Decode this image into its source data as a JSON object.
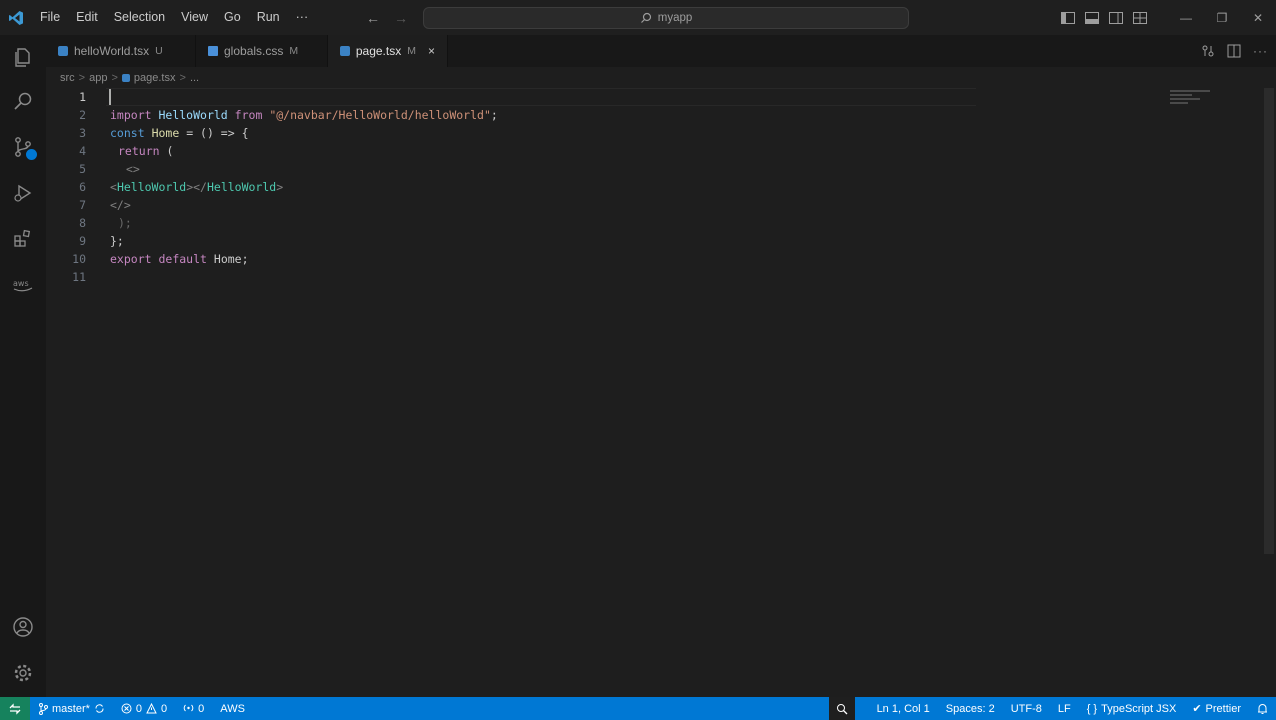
{
  "colors": {
    "accent": "#0078d4",
    "remote": "#16825d",
    "editor_bg": "#1e1e1e"
  },
  "menu": [
    "File",
    "Edit",
    "Selection",
    "View",
    "Go",
    "Run",
    "···"
  ],
  "search": {
    "text": "myapp"
  },
  "tabs": [
    {
      "label": "helloWorld.tsx",
      "status": "U"
    },
    {
      "label": "globals.css",
      "status": "M"
    },
    {
      "label": "page.tsx",
      "status": "M",
      "close": "×"
    }
  ],
  "breadcrumb": {
    "p1": "src",
    "p2": "app",
    "p3": "page.tsx",
    "sep": ">",
    "more": "..."
  },
  "code": {
    "l1": "1",
    "l2": "2",
    "l3": "3",
    "l4": "4",
    "l5": "5",
    "l6": "6",
    "l7": "7",
    "l8": "8",
    "l9": "9",
    "l10": "10",
    "l11": "11",
    "line2": {
      "kw": "import",
      "id": "HelloWorld",
      "from": "from",
      "str": "\"@/navbar/HelloWorld/helloWorld\"",
      "semi": ";"
    },
    "line3": {
      "kw": "const",
      "id": "Home",
      "rest": " = () => {"
    },
    "line4": {
      "kw": "return",
      "rest": " ("
    },
    "line5": {
      "text": "<>"
    },
    "line6": {
      "open": "<",
      "tag": "HelloWorld",
      "mid": "></",
      "tag2": "HelloWorld",
      "close": ">"
    },
    "line7": {
      "text": "</>"
    },
    "line8": {
      "text": ");"
    },
    "line9": {
      "text": "};"
    },
    "line10": {
      "kw": "export",
      "kw2": "default",
      "id": "Home",
      "semi": ";"
    }
  },
  "status": {
    "branch": "master*",
    "errors": "0",
    "warnings": "0",
    "ports": "0",
    "aws": "AWS",
    "position": "Ln 1, Col 1",
    "spaces": "Spaces: 2",
    "encoding": "UTF-8",
    "eol": "LF",
    "language": "TypeScript JSX",
    "formatter": "Prettier"
  }
}
